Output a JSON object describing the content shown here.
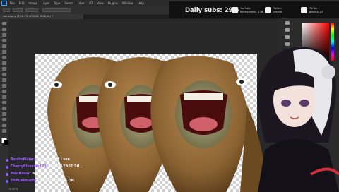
{
  "app": {
    "menu": [
      "File",
      "Edit",
      "Image",
      "Layer",
      "Type",
      "Select",
      "Filter",
      "3D",
      "View",
      "Plugins",
      "Window",
      "Help"
    ],
    "document_tab": "camel.png @ 16.7% (COVID, RGB/8#) *"
  },
  "overlay": {
    "daily_subs": "Daily subs: 29/5",
    "socials": [
      {
        "icon": "youtube-icon",
        "line1": "YouTube",
        "line2": "RileNonnom - 138"
      },
      {
        "icon": "twitter-icon",
        "line1": "Twitter",
        "line2": "rilkano"
      },
      {
        "icon": "tiktok-icon",
        "line1": "TikTok",
        "line2": "alead3423"
      }
    ]
  },
  "chat": [
    {
      "user": "BenitoMolar:",
      "message": "this is what I see",
      "color": "#9b59ff"
    },
    {
      "user": "CherryBlossom123:",
      "message": "OMI PLEASE SH...",
      "color": "#8a4fff"
    },
    {
      "user": "Mentillow:",
      "message": "oh hoh hoh",
      "color": "#a067ff"
    },
    {
      "user": "EitPunkmuffy:",
      "message": "WTH IS GOING ON",
      "color": "#7d5cff"
    }
  ],
  "status": {
    "zoom": "16.67%"
  },
  "colors": {
    "accent_blue": "#31a8ff",
    "chat_name": "#9b59ff"
  }
}
